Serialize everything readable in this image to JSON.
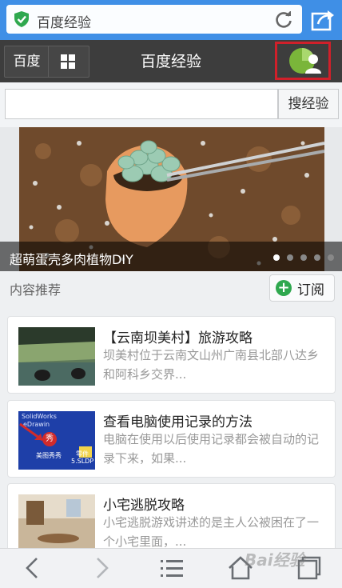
{
  "browser": {
    "url_text": "百度经验"
  },
  "header": {
    "baidu_label": "百度",
    "title": "百度经验"
  },
  "search": {
    "placeholder": "",
    "button_label": "搜经验"
  },
  "banner": {
    "caption": "超萌蛋壳多肉植物DIY",
    "slide_count": 5,
    "active_index": 0
  },
  "section": {
    "title": "内容推荐",
    "subscribe_label": "订阅"
  },
  "articles": [
    {
      "title": "【云南坝美村】旅游攻略",
      "desc": "坝美村位于云南文山州广南县北部八达乡和阿科乡交界..."
    },
    {
      "title": "查看电脑使用记录的方法",
      "desc": "电脑在使用以后使用记录都会被自动的记录下来，如果..."
    },
    {
      "title": "小宅逃脱攻略",
      "desc": "小宅逃脱游戏讲述的是主人公被困在了一个小宅里面，..."
    }
  ],
  "thumb2_text": {
    "line1": "SolidWorks",
    "line2": "eDrawin",
    "badge": "秀",
    "caption": "美图秀秀",
    "side1": "零件",
    "side2": "5.SLDP"
  },
  "watermark": "Bai经验",
  "colors": {
    "browser_blue": "#3f8fe6",
    "header_dark": "#3d3d3d",
    "accent_red": "#d0202a",
    "subscribe_green": "#2fa84f"
  },
  "icons": {
    "shield": "shield-check-icon",
    "reload": "reload-icon",
    "share": "share-icon",
    "grid": "grid-icon",
    "back": "back-arrow-icon",
    "forward": "forward-arrow-icon",
    "menu": "menu-icon",
    "home": "home-icon",
    "tabs": "tabs-icon"
  }
}
